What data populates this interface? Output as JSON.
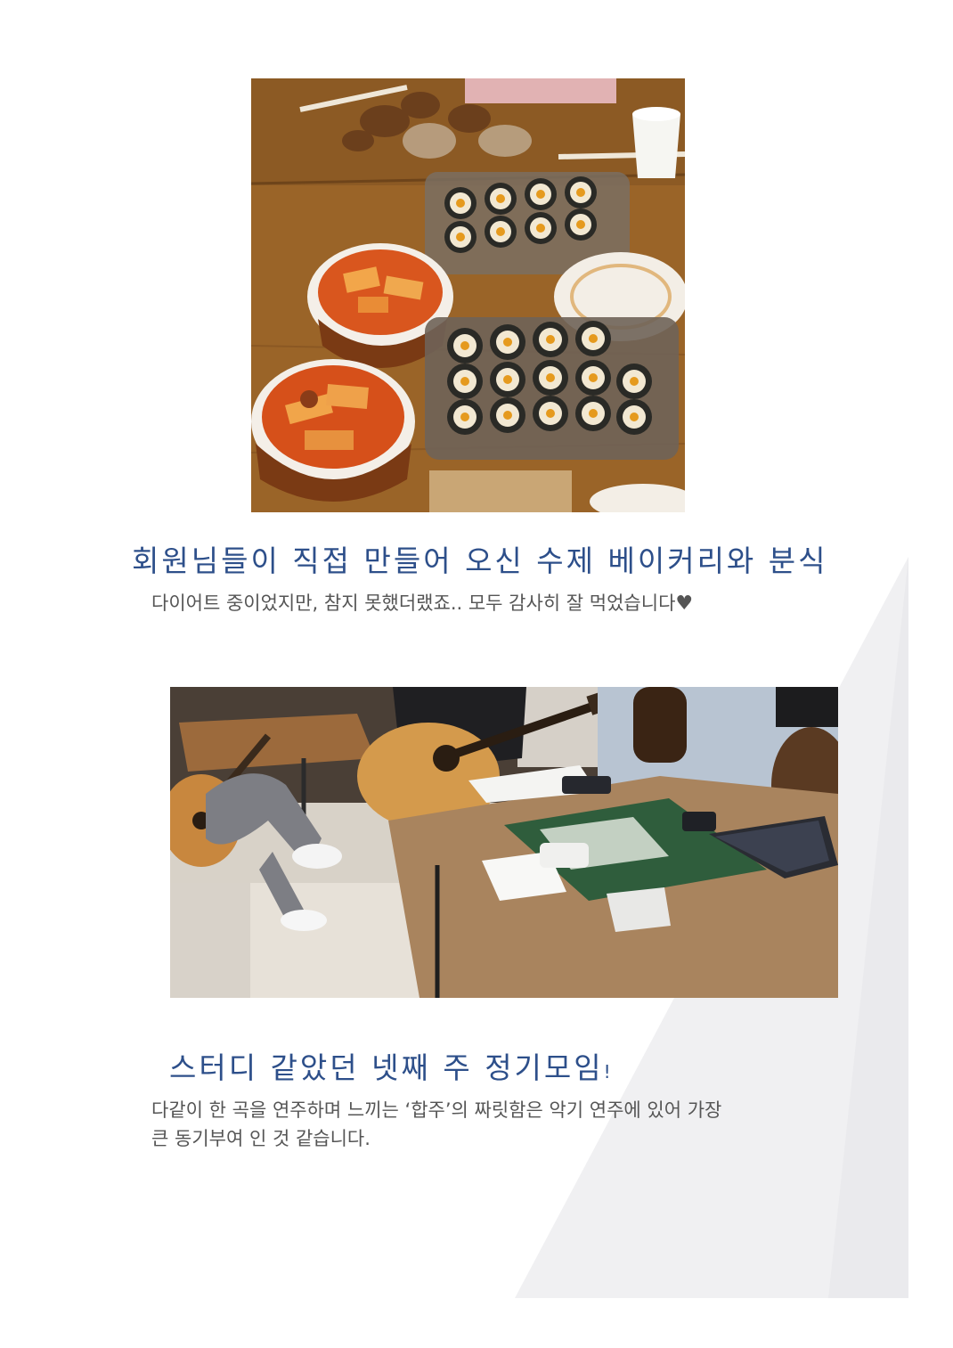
{
  "section1": {
    "title": "회원님들이 직접 만들어 오신 수제 베이커리와 분식",
    "description": "다이어트 중이었지만, 참지 못했더랬죠.. 모두 감사히 잘 먹었습니다",
    "heart_glyph": "♥"
  },
  "section2": {
    "title": "스터디 같았던 넷째 주 정기모임",
    "title_suffix": "!",
    "description_line1": "다같이 한 곡을 연주하며 느끼는 ‘합주’의 짜릿함은 악기 연주에 있어 가장",
    "description_line2": "큰 동기부여 인 것 같습니다."
  },
  "colors": {
    "title": "#2d4f8a",
    "body_text": "#555555",
    "background_shape": "#efeff1"
  }
}
